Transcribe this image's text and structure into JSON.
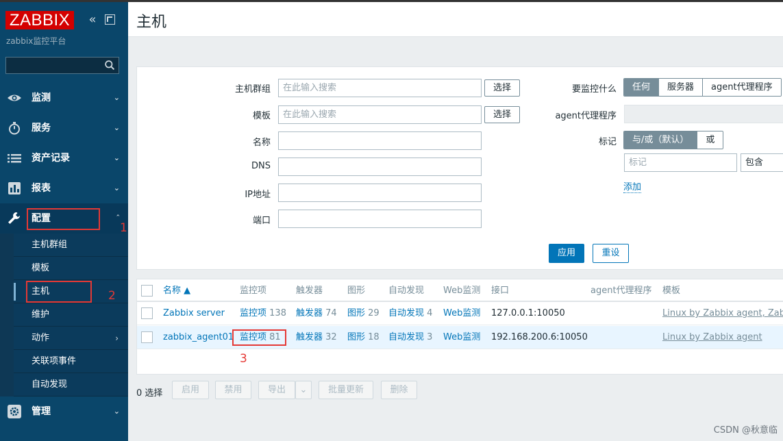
{
  "sidebar": {
    "logo": "ZABBIX",
    "subtitle": "zabbix监控平台",
    "search_placeholder": "",
    "items": [
      {
        "label": "监测",
        "icon": "eye-icon"
      },
      {
        "label": "服务",
        "icon": "stopwatch-icon"
      },
      {
        "label": "资产记录",
        "icon": "list-icon"
      },
      {
        "label": "报表",
        "icon": "bar-chart-icon"
      },
      {
        "label": "配置",
        "icon": "wrench-icon"
      },
      {
        "label": "管理",
        "icon": "gear-icon"
      }
    ],
    "config_sub": [
      "主机群组",
      "模板",
      "主机",
      "维护",
      "动作",
      "关联项事件",
      "自动发现"
    ]
  },
  "header": {
    "title": "主机"
  },
  "filter": {
    "host_group_label": "主机群组",
    "host_group_placeholder": "在此输入搜索",
    "template_label": "模板",
    "template_placeholder": "在此输入搜索",
    "select_label": "选择",
    "name_label": "名称",
    "dns_label": "DNS",
    "ip_label": "IP地址",
    "port_label": "端口",
    "monitored_by_label": "要监控什么",
    "monitored_by_options": [
      "任何",
      "服务器",
      "agent代理程序"
    ],
    "proxy_label": "agent代理程序",
    "tags_label": "标记",
    "tags_mode_options": [
      "与/或（默认）",
      "或"
    ],
    "tag_placeholder": "标记",
    "tag_operator": "包含",
    "add_link": "添加",
    "apply": "应用",
    "reset": "重设"
  },
  "table": {
    "headers": [
      "名称 ▲",
      "监控项",
      "触发器",
      "图形",
      "自动发现",
      "Web监测",
      "接口",
      "agent代理程序",
      "模板"
    ],
    "rows": [
      {
        "name": "Zabbix server",
        "items": "监控项",
        "items_count": "138",
        "triggers": "触发器",
        "triggers_count": "74",
        "graphs": "图形",
        "graphs_count": "29",
        "discovery": "自动发现",
        "discovery_count": "4",
        "web": "Web监测",
        "interface": "127.0.0.1:10050",
        "templates": "Linux by Zabbix agent, Zabbix"
      },
      {
        "name": "zabbix_agent01",
        "items": "监控项",
        "items_count": "81",
        "triggers": "触发器",
        "triggers_count": "32",
        "graphs": "图形",
        "graphs_count": "18",
        "discovery": "自动发现",
        "discovery_count": "3",
        "web": "Web监测",
        "interface": "192.168.200.6:10050",
        "templates": "Linux by Zabbix agent"
      }
    ]
  },
  "footer": {
    "selected": "0 选择",
    "buttons": [
      "启用",
      "禁用",
      "导出",
      "批量更新",
      "删除"
    ]
  },
  "annotations": [
    "1",
    "2",
    "3"
  ],
  "watermark": "CSDN @秋意临",
  "colors": {
    "sidebar_bg": "#0a466a",
    "accent": "#0275b8",
    "logo_red": "#d40000",
    "annotation_red": "#e53935"
  }
}
